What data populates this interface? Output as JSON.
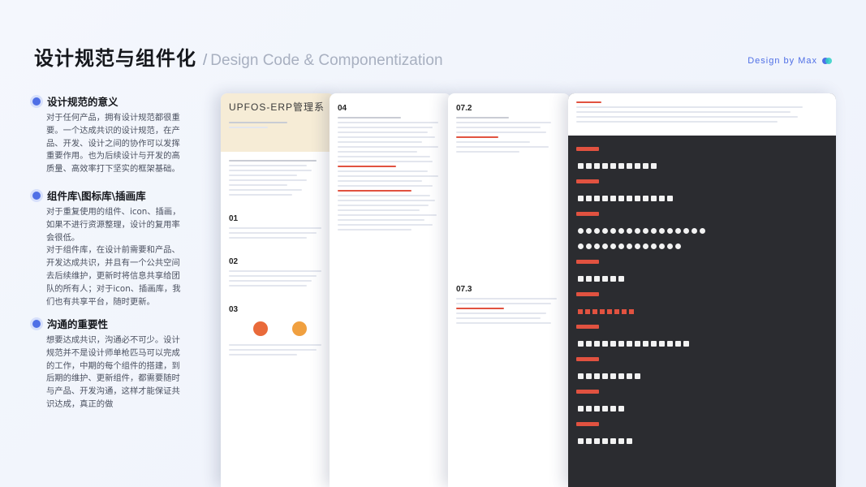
{
  "header": {
    "title": "设计规范与组件化",
    "slash": "/",
    "subtitle": "Design Code & Componentization",
    "brand": "Design by Max"
  },
  "sections": [
    {
      "title": "设计规范的意义",
      "body": "对于任何产品，拥有设计规范都很重要。一个达成共识的设计规范，在产品、开发、设计之间的协作可以发挥重要作用。也为后续设计与开发的高质量、高效率打下坚实的框架基础。"
    },
    {
      "title": "组件库\\图标库\\插画库",
      "body": "对于重复使用的组件、icon、插画，如果不进行资源整理，设计的复用率会很低。\n对于组件库，在设计前需要和产品、开发达成共识，并且有一个公共空间去后续维护，更新时将信息共享给团队的所有人；对于icon、插画库，我们也有共享平台，随时更新。"
    },
    {
      "title": "沟通的重要性",
      "body": "想要达成共识，沟通必不可少。设计规范并不是设计师单枪匹马可以完成的工作，中期的每个组件的搭建，到后期的维护、更新组件，都需要随时与产品、开发沟通，这样才能保证共识达成，真正的做"
    }
  ],
  "screens": {
    "doc1_title": "UPFOS-ERP管理系",
    "doc1_num1": "01",
    "doc1_num2": "02",
    "doc1_num3": "03",
    "doc2_num": "04",
    "doc3_num": "07.2",
    "doc3_num2": "07.3"
  },
  "colors": {
    "accent": "#4f6fe6",
    "red": "#e15240",
    "dark": "#2b2c30"
  }
}
